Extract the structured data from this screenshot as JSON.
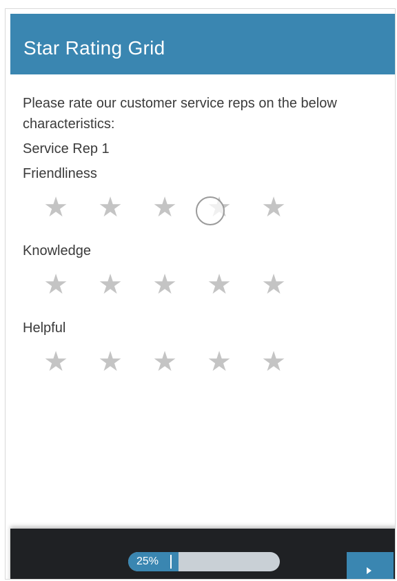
{
  "header": {
    "title": "Star Rating Grid"
  },
  "question": {
    "text": "Please rate our customer service reps on the below characteristics:",
    "subsection": "Service Rep 1",
    "rows": [
      {
        "label": "Friendliness",
        "rating": 0,
        "max": 5
      },
      {
        "label": "Knowledge",
        "rating": 0,
        "max": 5
      },
      {
        "label": "Helpful",
        "rating": 0,
        "max": 5
      }
    ]
  },
  "icons": {
    "star": "star-icon",
    "next": "play-icon"
  },
  "colors": {
    "accent": "#3a86b1",
    "star_inactive": "#c4c4c4",
    "footer_bg": "#1f2124"
  },
  "footer": {
    "progress_label": "25%",
    "progress_percent": 25
  }
}
